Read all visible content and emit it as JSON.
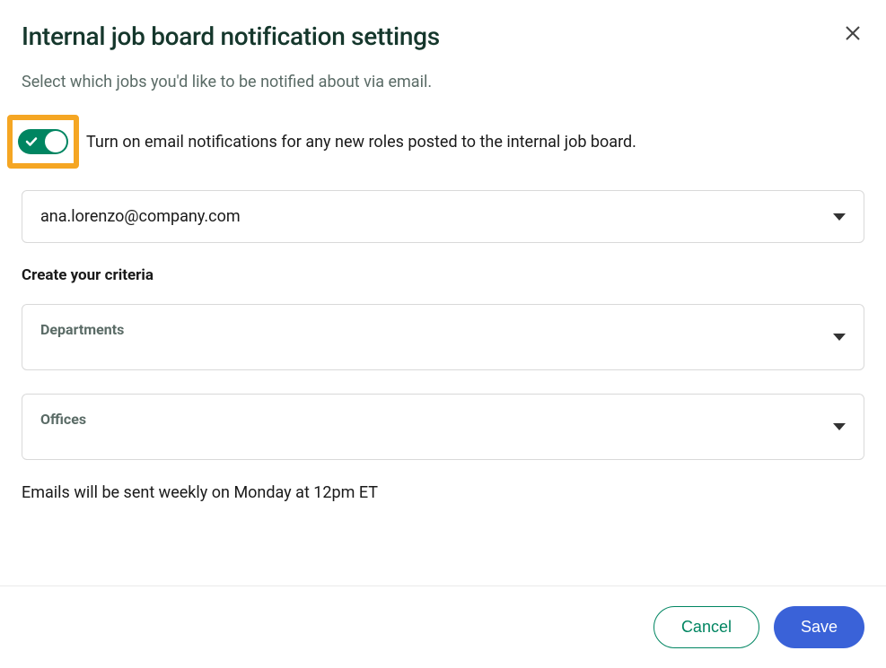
{
  "dialog": {
    "title": "Internal job board notification settings",
    "description": "Select which jobs you'd like to be notified about via email."
  },
  "toggle": {
    "label": "Turn on email notifications for any new roles posted to the internal job board.",
    "state": "on"
  },
  "email_select": {
    "value": "ana.lorenzo@company.com"
  },
  "criteria": {
    "heading": "Create your criteria",
    "departments_label": "Departments",
    "offices_label": "Offices"
  },
  "schedule": {
    "text": "Emails will be sent weekly on Monday at 12pm ET"
  },
  "footer": {
    "cancel_label": "Cancel",
    "save_label": "Save"
  }
}
